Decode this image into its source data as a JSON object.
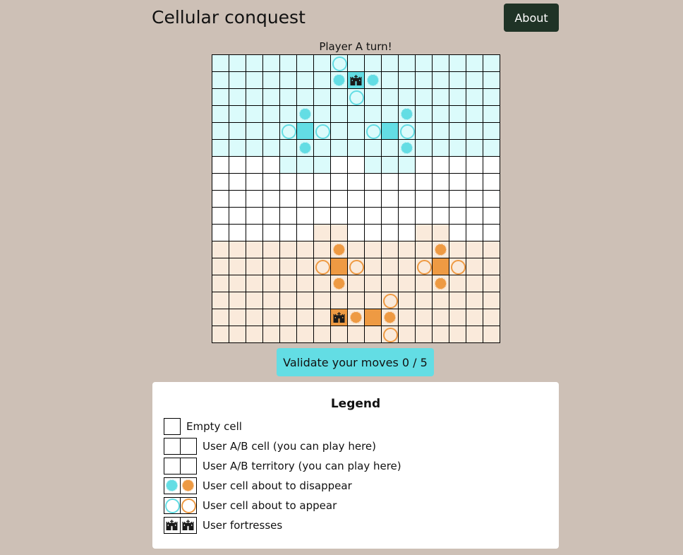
{
  "header": {
    "title": "Cellular conquest",
    "about_label": "About"
  },
  "game": {
    "turn_text": "Player A turn!",
    "board_size": 17,
    "colors": {
      "player_a_cell": "#63dde4",
      "player_b_cell": "#ee9a43",
      "player_a_territory": "#dbfbfb",
      "player_b_territory": "#faeadb",
      "empty": "#ffffff"
    },
    "rows": [
      "AAAAAAA@AAAAAAAAA",
      "AAAAAAA$F$AAAAAAA",
      "AAAAAAAA@AAAAAAAA",
      "AAAAA$AAAAA$AAAAA",
      "AAAA@O@AA@O@AAAAA",
      "AAAAA$AAAAA$AAAAA",
      "....AAA..AAA.....",
      ".................",
      ".................",
      ".................",
      "......bb....bb...",
      "bbbbbbb%bbbbb%bbb",
      "bbbbbb#X#bbb#X#bb",
      "bbbbbbb%bbbbb%bbb",
      "bbbbbbbbbb#bbbbbb",
      "bbbbbbbG%X%bbbbbb",
      "bbbbbbbbbb#bbbbbb"
    ],
    "cell_codes": {
      ".": "empty",
      "A": "a-territory",
      "O": "a-cell",
      "$": "a-disappear",
      "@": "a-appear",
      "F": "a-fortress",
      "b": "b-territory",
      "X": "b-cell",
      "%": "b-disappear",
      "#": "b-appear",
      "G": "b-fortress"
    },
    "validate_label": "Validate your moves 0 / 5"
  },
  "legend": {
    "title": "Legend",
    "items": [
      {
        "label": "Empty cell",
        "swatches": [
          "empty"
        ]
      },
      {
        "label": "User A/B cell (you can play here)",
        "swatches": [
          "a-cell",
          "b-cell"
        ]
      },
      {
        "label": "User A/B territory (you can play here)",
        "swatches": [
          "a-territory",
          "b-territory"
        ]
      },
      {
        "label": "User cell about to disappear",
        "swatches": [
          "a-disappear",
          "b-disappear"
        ]
      },
      {
        "label": "User cell about to appear",
        "swatches": [
          "a-appear",
          "b-appear"
        ]
      },
      {
        "label": "User fortresses",
        "swatches": [
          "a-fortress",
          "b-fortress"
        ]
      }
    ]
  }
}
